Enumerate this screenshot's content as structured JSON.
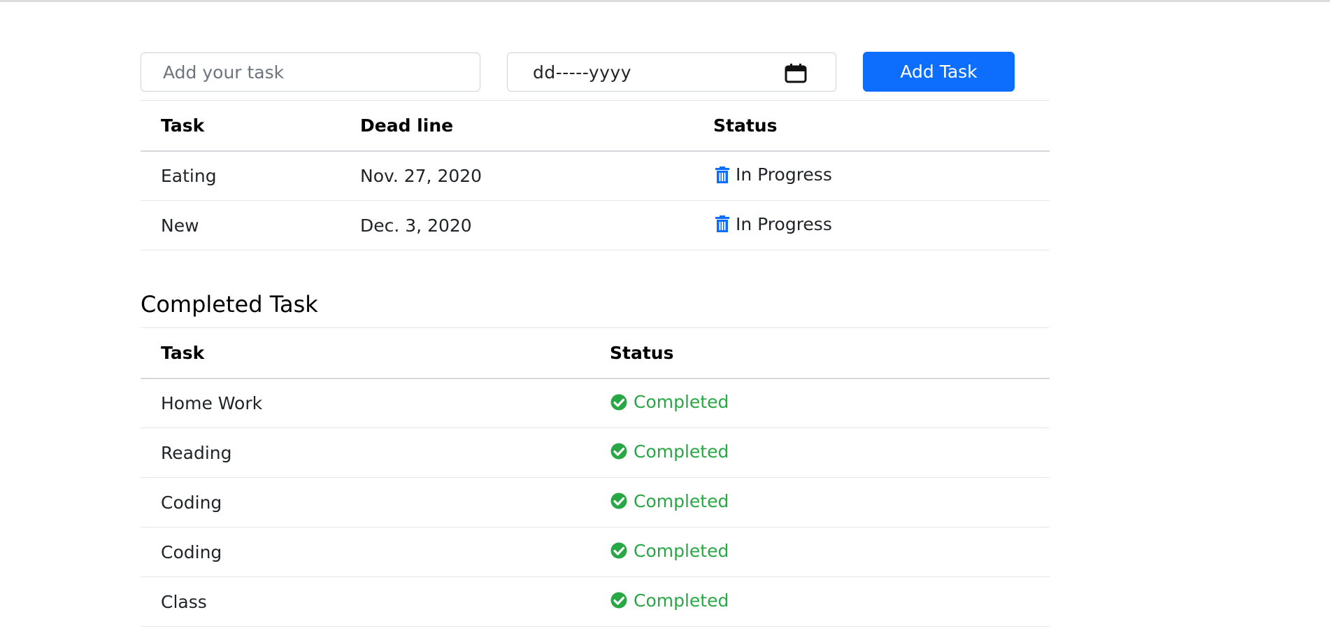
{
  "form": {
    "task_placeholder": "Add your task",
    "date_placeholder": "dd-----yyyy",
    "add_button_label": "Add Task"
  },
  "pending": {
    "headers": {
      "task": "Task",
      "deadline": "Dead line",
      "status": "Status"
    },
    "rows": [
      {
        "task": "Eating",
        "deadline": "Nov. 27, 2020",
        "status": "In Progress"
      },
      {
        "task": "New",
        "deadline": "Dec. 3, 2020",
        "status": "In Progress"
      }
    ]
  },
  "completed": {
    "title": "Completed Task",
    "headers": {
      "task": "Task",
      "status": "Status"
    },
    "rows": [
      {
        "task": "Home Work",
        "status": "Completed"
      },
      {
        "task": "Reading",
        "status": "Completed"
      },
      {
        "task": "Coding",
        "status": "Completed"
      },
      {
        "task": "Coding",
        "status": "Completed"
      },
      {
        "task": "Class",
        "status": "Completed"
      }
    ]
  },
  "colors": {
    "primary": "#0d6efd",
    "success": "#28a745",
    "trash_icon": "#0d6efd"
  },
  "icons": {
    "date": "calendar-icon",
    "in_progress": "trash-icon",
    "completed": "check-circle-icon"
  }
}
